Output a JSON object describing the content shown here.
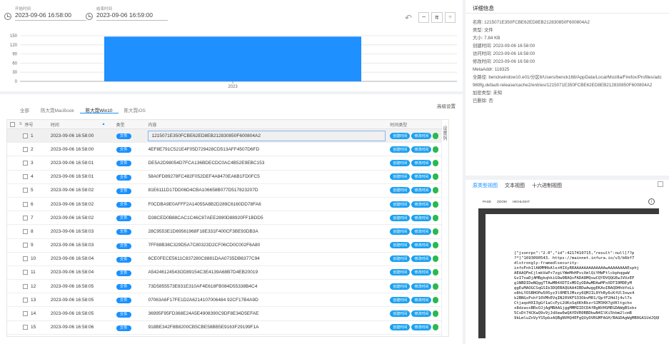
{
  "time_range": {
    "start_label": "开始时间",
    "start_value": "2023-09-06 16:58:00",
    "end_label": "结束时间",
    "end_value": "2023-09-06 16:59:00",
    "zoom_unit": "年"
  },
  "chart_data": {
    "type": "bar",
    "categories": [
      "2023"
    ],
    "values": [
      147
    ],
    "ylim": [
      0,
      150
    ],
    "yticks": [
      "150",
      "120",
      "90",
      "60",
      "30",
      "0"
    ],
    "grid": true,
    "color": "#1e90ff"
  },
  "tabs": [
    {
      "label": "全部"
    },
    {
      "label": "陈大霓MacBook"
    },
    {
      "label": "陈大霓Win10"
    },
    {
      "label": "陈大霓iOS"
    }
  ],
  "advanced_settings": "高级设置",
  "table": {
    "headers": {
      "no": "序号",
      "time": "时间",
      "type": "类型",
      "content": "内容",
      "tags": "时间类型"
    },
    "side_label": "设置列",
    "rows": [
      {
        "no": "1",
        "time": "2023-09-06 16:58:00",
        "type": "文件",
        "content": "1215071E350FCBE62ED8EB212830850F600804A2"
      },
      {
        "no": "2",
        "time": "2023-09-06 16:58:00",
        "type": "文件",
        "content": "4EF8E791C521E4F05D729428CD513AFF4507D6FD"
      },
      {
        "no": "3",
        "time": "2023-09-06 16:58:01",
        "type": "文件",
        "content": "DE5A2D98054D7FCA136BDECDC0AC4B52E9EBC153"
      },
      {
        "no": "4",
        "time": "2023-09-06 16:58:01",
        "type": "文件",
        "content": "58A0FD89278FC482F052DEF4A8470EA6B1FD0FC5"
      },
      {
        "no": "5",
        "time": "2023-09-06 16:58:02",
        "type": "文件",
        "content": "81E6111D17DD06D4CBA106658B077D517823207D"
      },
      {
        "no": "6",
        "time": "2023-09-06 16:58:02",
        "type": "文件",
        "content": "F0CDBA9E0AFFF2A14055A8B2D289C6160DD78FA6"
      },
      {
        "no": "7",
        "time": "2023-09-06 16:58:02",
        "type": "文件",
        "content": "D38CED0B88CAC1C46C87AEE2890D88920FF1BDD5"
      },
      {
        "no": "8",
        "time": "2023-09-06 16:58:03",
        "type": "文件",
        "content": "28C9553E1D69561968F18E331F400CF3BE93DB3A"
      },
      {
        "no": "9",
        "time": "2023-09-06 16:58:03",
        "type": "文件",
        "content": "7FF88B38C329D5A7C80323D2CF06CD0C002F6A80"
      },
      {
        "no": "10",
        "time": "2023-09-06 16:58:04",
        "type": "文件",
        "content": "6CE0FECE5611C837280C8881DAA0735DB6377C94"
      },
      {
        "no": "11",
        "time": "2023-09-06 16:58:04",
        "type": "文件",
        "content": "A54246124543OD89154C3E4139A68B7D4EB20019"
      },
      {
        "no": "12",
        "time": "2023-09-06 16:58:05",
        "type": "文件",
        "content": "73D5855573E831E310AF4E618FB084D55338B4C4"
      },
      {
        "no": "13",
        "time": "2023-09-06 16:58:05",
        "type": "文件",
        "content": "07063A6F17FE1D2A6214107006484 92CF17B4A9D"
      },
      {
        "no": "14",
        "time": "2023-09-06 16:58:05",
        "type": "文件",
        "content": "36995F95FD368E24A5E4908390C9DF8E34D5EFAE"
      },
      {
        "no": "15",
        "time": "2023-09-06 16:58:06",
        "type": "文件",
        "content": "918BE342F8B8200CB5CBE58BB5E9163F29199F1A"
      }
    ],
    "tag_created": "创建时间",
    "tag_modified": "修改时间"
  },
  "details": {
    "title": "详细信息",
    "name": "名称:  1215071E350FCBE62ED8EB212830850F600804A2",
    "type": "类型:  文件",
    "size": "大小:  7.84 KB",
    "created": "创建时间:  2023-09-06 16:58:00",
    "accessed": "访问时间:  2023-09-06 16:58:00",
    "modified": "修改时间:  2023-09-06 16:58:00",
    "meta": "MetaAddr:  118325",
    "path": "全路径:  benckwindow10.e01/分区6/Users/benck168/AppData/Local/Mozilla/Firefox/Profiles/adc969fg.default-release/cache2/entries/1215071E350FCBE62ED8EB212830850F600804A2",
    "encryption": "加密类型:  未知",
    "deleted": "已删除:  否"
  },
  "viewer": {
    "tabs": [
      "原类型视图",
      "文本视图",
      "十六进制视图"
    ],
    "toolbar": [
      "PAGE",
      "ZOOM",
      "HIGHLIGHT"
    ],
    "info": "i",
    "text": "[\"jsonrpc\":\"2.0\",\"id\":4217410715,\"result\":null]??p\n?*]\"1693090543. https://mainnet.infura.io/v3/b6bf7\ndlstrongly-framedlsecurity-\ninfoFnh1lAKMMHkAlo+HIXyRRAAAAAAAAAAAAAwAAAAAAAAEsphj\nAEAAQFmCjlmkVwP+7zgiYWmMhHPvcXmlQiYHWFtlcbphqgwW\nGvI7oaDjAMBgkqhkiG9w0BAQsFADA8MQswCQYDVQQGEwJVUzEP\ng1NBDIDeNQggTTAwMB4XDTIxMDIyODAwMDAwMFoXDTI0MDEyM\nggEuMAOGCSqGSIb3DQEBAQUAA4IBDwAwggEKAoIBAQDHhbYoLi\no8hLYOSBHOPw505yz3l0ME5JMszy6QMJIL0YhRy6cKfUl3xwx4\nk2BNGsPshf10VMhEVqIN20VKFS33ObvM01/QpfF2HdJj4vl7x\nCtjaqoHXI3gGf1aCcPyi2UKoSqXKhRkzrSIM3HX7gVKltgcho\nx8dzasxBRsOJjAgMBAAGjggMMMIIDCDAfBgNVHSMEGDAWgBSxbs\n5CsDt74CKaQ9v9jJdXew0wQAYDVR0RBDkwN4IlKi5hbm2lcmR\n9kLmluZnVyYS5pbzAQBgNVHQ4EFgQUyDVRGMFAGH/BAGDAgWgMB0GA1UdJQQW"
  }
}
